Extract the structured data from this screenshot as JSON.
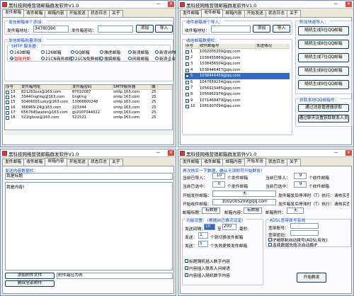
{
  "app": {
    "title": "黑科技网络营销邮箱群发软件V1.0",
    "min": "—",
    "close": "✕"
  },
  "tabs": [
    "发件邮箱",
    "收件邮箱",
    "邮箱内容",
    "开始发送",
    "状态日志",
    "关于"
  ],
  "sender": {
    "group_title": "发信邮箱单个添加：",
    "addr_label": "发件箱地址：",
    "addr_value": "34780390",
    "pwd_label": "发件箱密码：",
    "pwd_value": "",
    "add_button": "添加",
    "import_button": "导入",
    "batch_title": "发信邮箱批量添加：",
    "smtp_title": "SMTP 服务器：",
    "smtp_options": [
      "163邮箱",
      "126邮箱",
      "QQ邮箱",
      "雅虎邮箱",
      "新浪邮箱",
      "新浪VIP邮箱",
      "智能判断",
      "21CN商务邮箱",
      "21CN免费邮箱",
      "搜狐邮箱",
      "网易邮箱",
      "新浪企业邮箱"
    ],
    "smtp_selected": 6,
    "columns": [
      "序号",
      "发件箱地址",
      "发件箱密码",
      "SMTP服务器",
      "端"
    ],
    "rows": [
      [
        "13",
        "821263sxs@163.com",
        "87032087",
        "smtp.163.com",
        "25"
      ],
      [
        "14",
        "3344tingting@163.com",
        "tingting",
        "smtp.163.com",
        "25"
      ],
      [
        "15",
        "50406091uzky@163.com",
        "13066800248",
        "smtp.163.com",
        "25"
      ],
      [
        "16",
        "366969-24@163.com",
        "223344",
        "smtp.163.com",
        "25"
      ],
      [
        "17",
        "656764Swater@163.com",
        "gs2007044022",
        "smtp.163.com",
        "25"
      ],
      [
        "18",
        "521lglove@163.com",
        "521521",
        "smtp.163.com",
        "25"
      ]
    ]
  },
  "recipient": {
    "group_title": "收件邮箱单个导入：",
    "addr_label": "收件箱地址：",
    "add_button": "添加",
    "import_button": "导入",
    "list_title": "收信邮箱数据栏：",
    "columns": [
      "序号",
      "收件邮箱号",
      "发送情况"
    ],
    "rows": [
      [
        "1",
        "1002005209@qq.com",
        ""
      ],
      [
        "2",
        "1038455869@qq.com",
        ""
      ],
      [
        "3",
        "1038456504@qq.com",
        ""
      ],
      [
        "4",
        "1038446457@qq.com",
        ""
      ],
      [
        "5",
        "1038444459@qq.com",
        ""
      ],
      [
        "6",
        "1047659234@qq.com",
        ""
      ],
      [
        "7",
        "1056923485@qq.com",
        ""
      ],
      [
        "8",
        "1056862974@qq.com",
        ""
      ],
      [
        "9",
        "1071469479@qq.com",
        ""
      ],
      [
        "10",
        "1081907094@qq.com",
        ""
      ]
    ],
    "selected_row": 4,
    "quick_title": "附加快速导入：",
    "gen_buttons": [
      "随机生成5位QQ邮箱",
      "随机生成6位QQ邮箱",
      "随机生成7位QQ邮箱",
      "随机生成8位QQ邮箱",
      "随机生成9位QQ邮箱"
    ],
    "local_title": "获取本地QQ邮箱号：",
    "local_buttons": [
      "通过消息管理器获取",
      "通过聊天设置获取联系人员"
    ]
  },
  "content": {
    "group_title": "发送内容数据栏：",
    "subject": "我是标题",
    "body": "我是内容!",
    "attach_add": "添加附件文件",
    "attach_path": "附件路径为表",
    "attach_delete": "删除全部附件"
  },
  "send": {
    "group_title": "再次核实一下数据，确认无误即可开始群发!",
    "r1": [
      "当前已导入：",
      "10",
      "个发件邮箱",
      "当前已导入：",
      "9",
      "个收件邮箱"
    ],
    "r2": [
      "当前已选中：",
      "0",
      "个发件邮箱",
      "当前已选中：",
      "9",
      "个收件邮箱"
    ],
    "start_send_label": "开始发件邮箱：",
    "start_send_value": "无",
    "send_note": "发件箱发后停滞时（T）执行：请核实查确",
    "start_recv_label": "开始收件邮箱：",
    "start_recv_value": "1002005209@qq.com",
    "recv_note": "发件箱发后停滞时（T）执行：请核实查确",
    "title_label": "邮箱标题：",
    "title_value": "有数据",
    "content_label": "邮箱内容：",
    "content_value": "有数据",
    "attach_label": "邮箱附件：",
    "attach_value": "无",
    "func_title": "功能设置：（根据自己情况设定）",
    "interval_label": "发送间隔：",
    "interval_from": "10",
    "interval_to_label": "至",
    "interval_to": "200",
    "interval_unit": "毫秒",
    "sendcount_label": "发送：",
    "sendcount_value": "1",
    "sendcount_unit": "个就切换发件邮箱",
    "sendcount2_label": "发送：",
    "sendcount2_value": "5",
    "sendcount2_unit": "个失败更换发件邮箱",
    "opts": [
      {
        "label": "标题随机插入数字内容",
        "checked": true
      },
      {
        "label": "内容插入联系人问候语",
        "checked": true
      },
      {
        "label": "内容插入随机数字内容",
        "checked": true
      }
    ],
    "adsl_title": "ADSL宽带拨号有效",
    "adsl_user_label": "宽带账号：",
    "adsl_pwd_label": "宽带密码：",
    "adsl_opts": [
      "IP被限制自动拨号(ADSL有效)",
      "连续数据失败次自动换IP"
    ],
    "start_button": "开始群发"
  }
}
